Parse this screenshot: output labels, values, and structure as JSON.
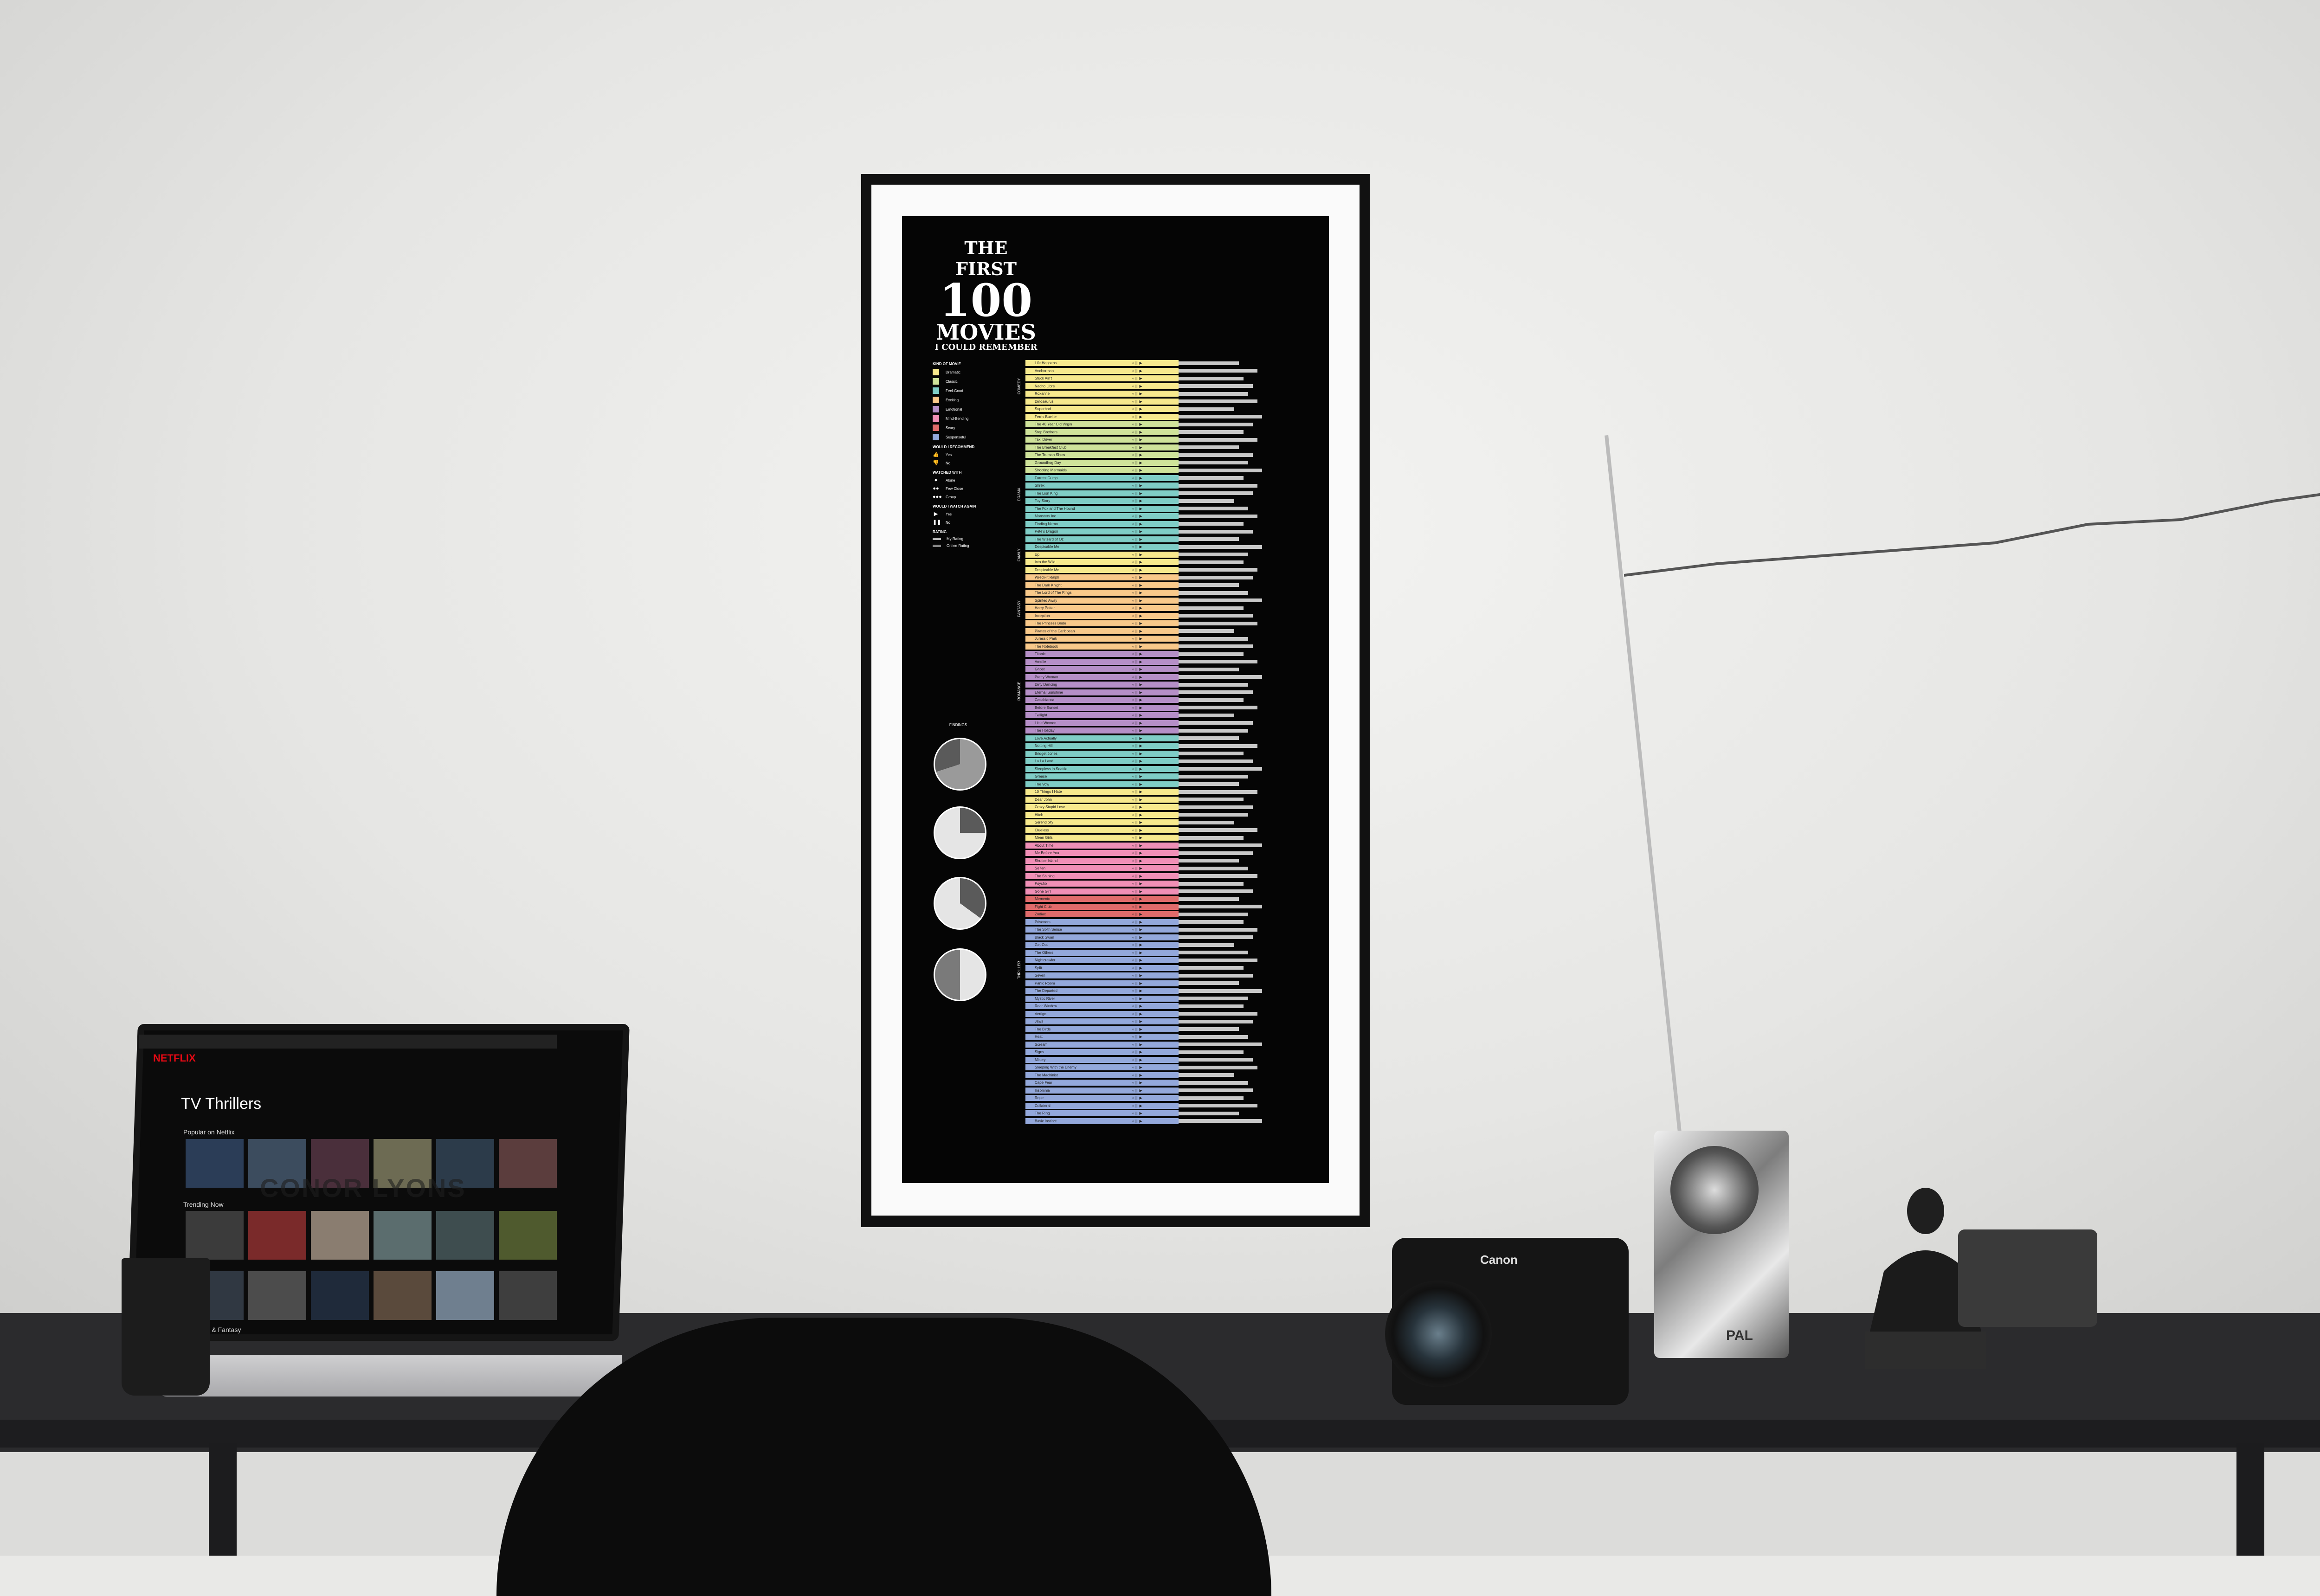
{
  "poster": {
    "title_line1": "THE FIRST",
    "title_number": "100",
    "title_line2": "MOVIES",
    "title_line3": "I COULD REMEMBER",
    "legend": {
      "kind_header": "KIND OF MOVIE",
      "kinds": [
        {
          "label": "Dramatic",
          "color": "#f7e98d"
        },
        {
          "label": "Classic",
          "color": "#cfe39a"
        },
        {
          "label": "Feel-Good",
          "color": "#7fcdc6"
        },
        {
          "label": "Exciting",
          "color": "#f9c98a"
        },
        {
          "label": "Emotional",
          "color": "#b58fc7"
        },
        {
          "label": "Mind-Bending",
          "color": "#f08fb6"
        },
        {
          "label": "Scary",
          "color": "#e06b6b"
        },
        {
          "label": "Suspenseful",
          "color": "#93a8db"
        }
      ],
      "recommend_header": "WOULD I RECOMMEND",
      "recommend": [
        "Yes",
        "No"
      ],
      "watched_header": "WATCHED WITH",
      "watched": [
        "Alone",
        "Few Close",
        "Group"
      ],
      "again_header": "WOULD I WATCH AGAIN",
      "again": [
        "Yes",
        "No"
      ],
      "rating_header": "RATING",
      "rating": [
        "My Rating",
        "Online Rating"
      ]
    },
    "findings_header": "FINDINGS",
    "groups": [
      "COMEDY",
      "DRAMA",
      "FAMILY",
      "FANTASY",
      "ROMANCE",
      "THRILLER"
    ],
    "movies": [
      "Life Happens",
      "Anchorman",
      "Stuck Ain't",
      "Nacho Libre",
      "Roxanne",
      "Dinosaurus",
      "Superbad",
      "Ferris Bueller",
      "The 40 Year Old Virgin",
      "Step Brothers",
      "Taxi Driver",
      "The Breakfast Club",
      "The Truman Show",
      "Groundhog Day",
      "Shooting Mermaids",
      "Forrest Gump",
      "Shrek",
      "The Lion King",
      "Toy Story",
      "The Fox and The Hound",
      "Monsters Inc",
      "Finding Nemo",
      "Pete's Dragon",
      "The Wizard of Oz",
      "Despicable Me",
      "Up",
      "Into the Wild",
      "Despicable Me",
      "Wreck-It Ralph",
      "The Dark Knight",
      "The Lord of The Rings",
      "Spirited Away",
      "Harry Potter",
      "Inception",
      "The Princess Bride",
      "Pirates of the Caribbean",
      "Jurassic Park",
      "The Notebook",
      "Titanic",
      "Amelie",
      "Ghost",
      "Pretty Woman",
      "Dirty Dancing",
      "Eternal Sunshine",
      "Casablanca",
      "Before Sunset",
      "Twilight",
      "Little Women",
      "The Holiday",
      "Love Actually",
      "Notting Hill",
      "Bridget Jones",
      "La La Land",
      "Sleepless in Seattle",
      "Grease",
      "The Vow",
      "10 Things I Hate",
      "Dear John",
      "Crazy Stupid Love",
      "Hitch",
      "Serendipity",
      "Clueless",
      "Mean Girls",
      "About Time",
      "Me Before You",
      "Shutter Island",
      "Se7en",
      "The Shining",
      "Psycho",
      "Gone Girl",
      "Memento",
      "Fight Club",
      "Zodiac",
      "Prisoners",
      "The Sixth Sense",
      "Black Swan",
      "Get Out",
      "The Others",
      "Nightcrawler",
      "Split",
      "Seven",
      "Panic Room",
      "The Departed",
      "Mystic River",
      "Rear Window",
      "Vertigo",
      "Jaws",
      "The Birds",
      "Heat",
      "Scream",
      "Signs",
      "Misery",
      "Sleeping With the Enemy",
      "The Machinist",
      "Cape Fear",
      "Insomnia",
      "Rope",
      "Collateral",
      "The Ring",
      "Basic Instinct"
    ]
  }
}
